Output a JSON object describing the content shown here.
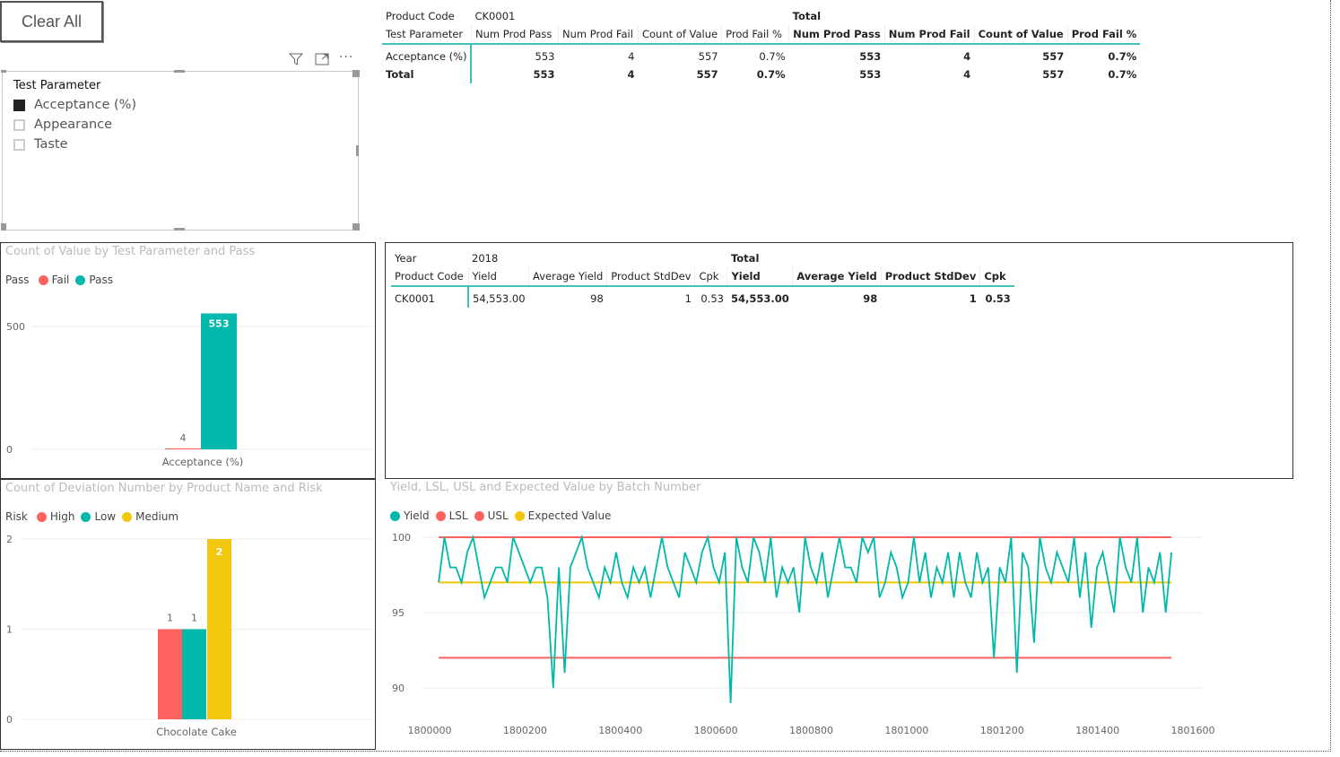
{
  "clear_button": "Clear All",
  "slicer": {
    "title": "Test Parameter",
    "items": [
      {
        "label": "Acceptance (%)",
        "checked": true
      },
      {
        "label": "Appearance",
        "checked": false
      },
      {
        "label": "Taste",
        "checked": false
      }
    ],
    "icons": [
      "filter-icon",
      "focus-mode-icon",
      "more-options-icon"
    ]
  },
  "matrix1": {
    "row1_label": "Product Code",
    "product_code": "CK0001",
    "total_label": "Total",
    "row2_label": "Test Parameter",
    "columns": [
      "Num Prod Pass",
      "Num Prod Fail",
      "Count of Value",
      "Prod Fail %"
    ],
    "rows": [
      {
        "label": "Acceptance (%)",
        "values": [
          "553",
          "4",
          "557",
          "0.7%"
        ],
        "totals": [
          "553",
          "4",
          "557",
          "0.7%"
        ]
      },
      {
        "label": "Total",
        "values": [
          "553",
          "4",
          "557",
          "0.7%"
        ],
        "totals": [
          "553",
          "4",
          "557",
          "0.7%"
        ]
      }
    ]
  },
  "matrix2": {
    "row1_label": "Year",
    "year": "2018",
    "total_label": "Total",
    "row2_label": "Product Code",
    "columns": [
      "Yield",
      "Average Yield",
      "Product StdDev",
      "Cpk"
    ],
    "rows": [
      {
        "label": "CK0001",
        "values": [
          "54,553.00",
          "98",
          "1",
          "0.53"
        ],
        "totals": [
          "54,553.00",
          "98",
          "1",
          "0.53"
        ]
      }
    ]
  },
  "colors": {
    "fail": "#fd625e",
    "pass": "#01b8aa",
    "high": "#fd625e",
    "low": "#01b8aa",
    "medium": "#f2c80f",
    "yield": "#01b8aa",
    "lsl": "#fd625e",
    "usl": "#fd625e",
    "expected": "#f2c80f"
  },
  "chart_data": [
    {
      "type": "bar",
      "title": "Count of Value by Test Parameter and Pass",
      "legend_title": "Pass",
      "legend_position": "top-left",
      "categories": [
        "Acceptance (%)"
      ],
      "series": [
        {
          "name": "Fail",
          "values": [
            4
          ]
        },
        {
          "name": "Pass",
          "values": [
            553
          ]
        }
      ],
      "yticks": [
        "0",
        "500"
      ],
      "ylim": [
        0,
        553
      ],
      "grid": true
    },
    {
      "type": "bar",
      "title": "Count of Deviation Number by Product Name and Risk",
      "legend_title": "Risk",
      "legend_position": "top-left",
      "categories": [
        "Chocolate Cake"
      ],
      "series": [
        {
          "name": "High",
          "values": [
            1
          ]
        },
        {
          "name": "Low",
          "values": [
            1
          ]
        },
        {
          "name": "Medium",
          "values": [
            2
          ]
        }
      ],
      "yticks": [
        "0",
        "1",
        "2"
      ],
      "ylim": [
        0,
        2
      ],
      "grid": true
    },
    {
      "type": "line",
      "title": "Yield, LSL, USL and Expected Value by Batch Number",
      "legend_position": "top-left",
      "legend": [
        "Yield",
        "LSL",
        "USL",
        "Expected Value"
      ],
      "xticks": [
        "1800000",
        "1800200",
        "1800400",
        "1800600",
        "1800800",
        "1801000",
        "1801200",
        "1801400",
        "1801600"
      ],
      "yticks": [
        "90",
        "95",
        "100"
      ],
      "xlim": [
        1800000,
        1801600
      ],
      "ylim": [
        88.5,
        100
      ],
      "grid": true,
      "lsl": 92,
      "usl": 100,
      "expected": 97,
      "x": [
        1800019,
        1800031,
        1800043,
        1800055,
        1800067,
        1800079,
        1800091,
        1800103,
        1800115,
        1800127,
        1800139,
        1800151,
        1800163,
        1800175,
        1800187,
        1800199,
        1800211,
        1800223,
        1800235,
        1800247,
        1800259,
        1800271,
        1800283,
        1800295,
        1800307,
        1800319,
        1800331,
        1800343,
        1800355,
        1800367,
        1800379,
        1800391,
        1800403,
        1800415,
        1800427,
        1800439,
        1800451,
        1800463,
        1800475,
        1800487,
        1800499,
        1800511,
        1800523,
        1800535,
        1800547,
        1800559,
        1800571,
        1800583,
        1800595,
        1800607,
        1800619,
        1800631,
        1800643,
        1800655,
        1800667,
        1800679,
        1800691,
        1800703,
        1800715,
        1800727,
        1800739,
        1800751,
        1800763,
        1800775,
        1800787,
        1800799,
        1800811,
        1800823,
        1800835,
        1800847,
        1800859,
        1800871,
        1800883,
        1800895,
        1800907,
        1800919,
        1800931,
        1800943,
        1800955,
        1800967,
        1800979,
        1800991,
        1801003,
        1801015,
        1801027,
        1801039,
        1801051,
        1801063,
        1801075,
        1801087,
        1801099,
        1801111,
        1801123,
        1801135,
        1801147,
        1801159,
        1801171,
        1801183,
        1801195,
        1801207,
        1801219,
        1801231,
        1801243,
        1801255,
        1801267,
        1801279,
        1801291,
        1801303,
        1801315,
        1801327,
        1801339,
        1801351,
        1801363,
        1801375,
        1801387,
        1801399,
        1801411,
        1801423,
        1801435,
        1801447,
        1801459,
        1801471,
        1801483,
        1801495,
        1801507,
        1801519,
        1801531,
        1801543,
        1801555
      ],
      "yield": [
        97,
        100,
        98,
        98,
        97,
        99,
        100,
        98,
        96,
        97,
        98,
        98,
        97,
        100,
        99,
        98,
        97,
        98,
        98,
        96,
        90,
        98,
        91,
        98,
        99,
        100,
        98,
        97,
        96,
        98,
        97,
        99,
        97,
        96,
        98,
        97,
        98,
        96,
        98,
        100,
        98,
        97,
        96,
        99,
        98,
        97,
        99,
        100,
        98,
        97,
        99,
        89,
        100,
        98,
        97,
        100,
        99,
        97,
        100,
        96,
        98,
        97,
        98,
        95,
        100,
        98,
        97,
        99,
        96,
        98,
        100,
        98,
        98,
        97,
        100,
        99,
        100,
        96,
        97,
        99,
        98,
        96,
        97,
        100,
        97,
        99,
        96,
        98,
        97,
        99,
        96,
        99,
        97,
        96,
        99,
        97,
        98,
        92,
        98,
        97,
        100,
        91,
        99,
        98,
        93,
        100,
        98,
        97,
        99,
        98,
        97,
        100,
        96,
        99,
        94,
        98,
        99,
        97,
        95,
        100,
        98,
        97,
        100,
        95,
        98,
        97,
        99,
        95,
        99
      ]
    }
  ]
}
